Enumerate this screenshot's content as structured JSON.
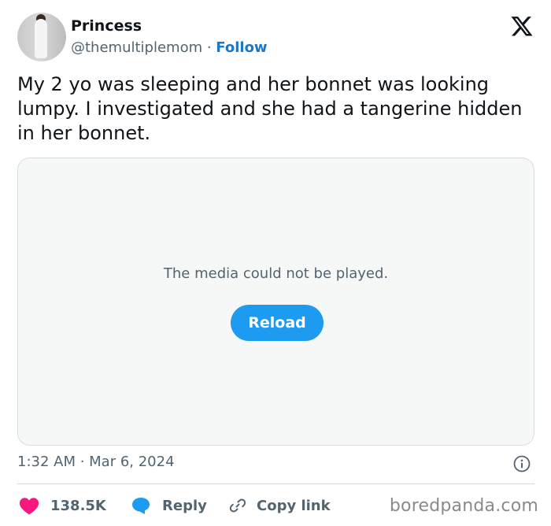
{
  "author": {
    "name": "Princess",
    "handle": "@themultiplemom",
    "separator": " · ",
    "follow_label": "Follow"
  },
  "tweet": {
    "text": "My 2 yo was sleeping and her bonnet was looking lumpy. I investigated and she had a tangerine hidden in her bonnet."
  },
  "media": {
    "message": "The media could not be played.",
    "reload_label": "Reload"
  },
  "meta": {
    "timestamp": "1:32 AM · Mar 6, 2024"
  },
  "actions": {
    "like_count": "138.5K",
    "reply_label": "Reply",
    "copy_label": "Copy link"
  },
  "watermark": "boredpanda.com",
  "colors": {
    "accent": "#1d9bf0",
    "follow": "#1d77c7",
    "like": "#f91880",
    "muted": "#536471"
  },
  "icons": {
    "platform": "x-logo-icon",
    "info": "info-icon",
    "like": "heart-icon",
    "reply": "speech-bubble-icon",
    "copy": "link-icon"
  }
}
